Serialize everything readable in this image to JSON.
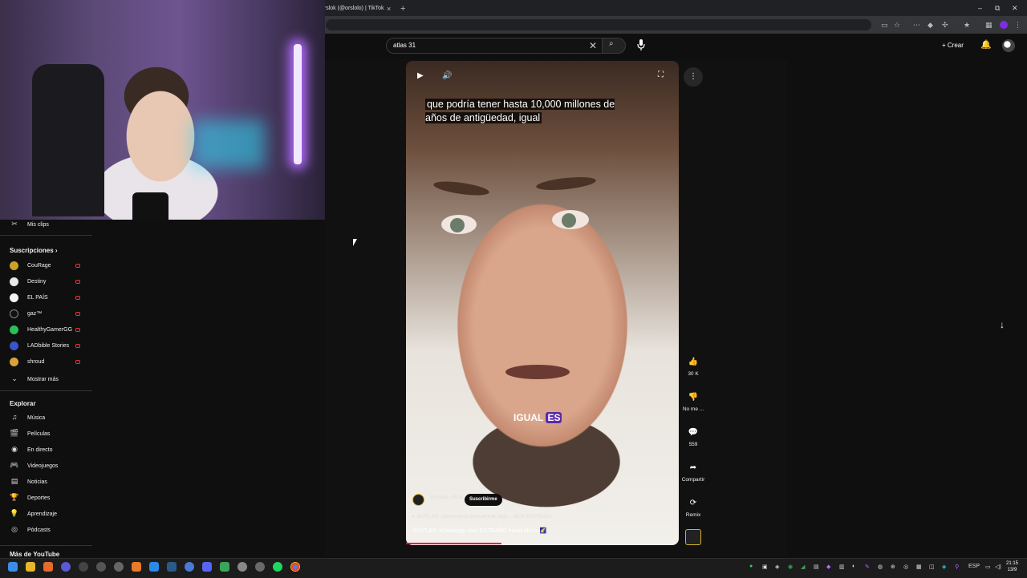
{
  "browser": {
    "tab_title": "orslok (@orslolo) | TikTok",
    "tab_close": "×",
    "tab_new": "+",
    "window_controls": [
      "–",
      "⧉",
      "✕"
    ]
  },
  "header": {
    "search_value": "atlas 31",
    "search_clear": "✕",
    "search_icon": "⌕",
    "create_label": "+ Crear",
    "bell_icon": "🔔"
  },
  "sidebar": {
    "clips": {
      "icon": "✂",
      "label": "Mis clips"
    },
    "subscriptions_header": "Suscripciones  ›",
    "subscriptions": [
      {
        "label": "CouRage",
        "color": "#c9a227"
      },
      {
        "label": "Destiny",
        "color": "#e8e8e8"
      },
      {
        "label": "EL PAÍS",
        "color": "#f4f4f4"
      },
      {
        "label": "gaz™",
        "color": "#111111"
      },
      {
        "label": "HealthyGamerGG",
        "color": "#2bbf55"
      },
      {
        "label": "LADbible Stories",
        "color": "#3a54c9"
      },
      {
        "label": "shroud",
        "color": "#d8a23a"
      }
    ],
    "show_more": {
      "icon": "⌄",
      "label": "Mostrar más"
    },
    "explore_header": "Explorar",
    "explore": [
      {
        "icon": "♫",
        "label": "Música"
      },
      {
        "icon": "🎬",
        "label": "Películas"
      },
      {
        "icon": "◉",
        "label": "En directo"
      },
      {
        "icon": "🎮",
        "label": "Videojuegos"
      },
      {
        "icon": "▤",
        "label": "Noticias"
      },
      {
        "icon": "🏆",
        "label": "Deportes"
      },
      {
        "icon": "💡",
        "label": "Aprendizaje"
      },
      {
        "icon": "◎",
        "label": "Pódcasts"
      }
    ],
    "more_header": "Más de YouTube"
  },
  "video": {
    "subtitle": "que podría tener hasta 10,000 millones de años de antigüedad, igual",
    "caption_word1": "IGUAL",
    "caption_word2": "ES",
    "channel_name": "@orslolo_oficial",
    "subscribe_label": "Suscribirme",
    "playlist": "▸  3I/ATLAS: Astrónomos encuentran algo... MUY EXTRAÑO",
    "title": "3I/ATLAS: el hallazgo más EXTRAÑO hasta ahora 🌠",
    "progress": 0.35,
    "controls": {
      "play": "▶",
      "volume": "🔊",
      "fullscreen": "⛶",
      "more": "⋮"
    }
  },
  "actions": [
    {
      "icon": "👍",
      "label": "30 K"
    },
    {
      "icon": "👎",
      "label": "No me ..."
    },
    {
      "icon": "💬",
      "label": "559"
    },
    {
      "icon": "➦",
      "label": "Compartir"
    },
    {
      "icon": "⟳",
      "label": "Remix"
    }
  ],
  "nav": {
    "next_icon": "↓"
  },
  "taskbar": {
    "lang": "ESP",
    "time": "21:15",
    "date": "13/9"
  }
}
